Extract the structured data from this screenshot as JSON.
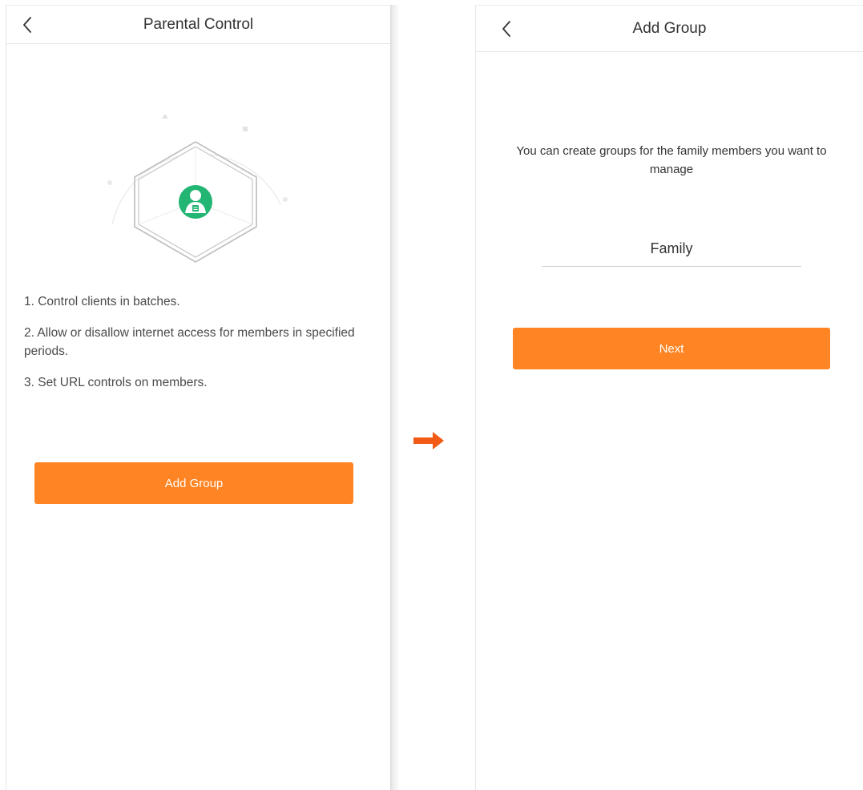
{
  "colors": {
    "accent": "#ff8423",
    "arrow": "#f25a16",
    "avatar_green": "#22b573",
    "text": "#333333",
    "divider": "#e4e4e4"
  },
  "left_screen": {
    "title": "Parental Control",
    "back_icon": "chevron-left-icon",
    "illustration_icon": "user-hexagon-icon",
    "features": [
      "1. Control clients in batches.",
      "2. Allow or disallow internet access for members in specified periods.",
      "3. Set URL controls on members."
    ],
    "add_group_label": "Add Group"
  },
  "flow_arrow_icon": "arrow-right-icon",
  "right_screen": {
    "title": "Add Group",
    "back_icon": "chevron-left-icon",
    "intro": "You can create groups for the family members you want to manage",
    "group_name_value": "Family",
    "next_label": "Next"
  }
}
